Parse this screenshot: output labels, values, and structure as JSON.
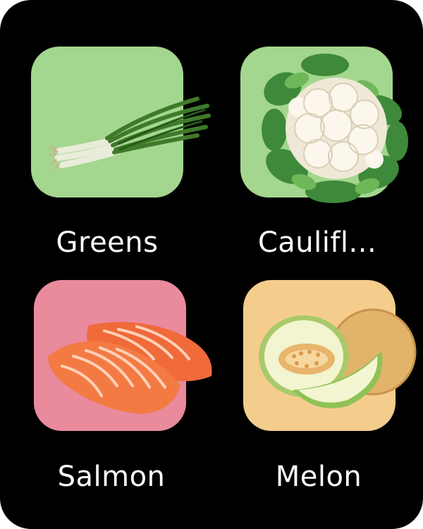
{
  "apps": [
    {
      "name": "Greens",
      "tile_color": "#a3d68f",
      "icon": "green-onion-icon"
    },
    {
      "name": "Caulifl...",
      "tile_color": "#a3d68f",
      "icon": "cauliflower-icon"
    },
    {
      "name": "Salmon",
      "tile_color": "#e98a9d",
      "icon": "salmon-icon"
    },
    {
      "name": "Melon",
      "tile_color": "#f4cd8d",
      "icon": "melon-icon"
    }
  ],
  "colors": {
    "background": "#000000",
    "label": "#ffffff"
  }
}
